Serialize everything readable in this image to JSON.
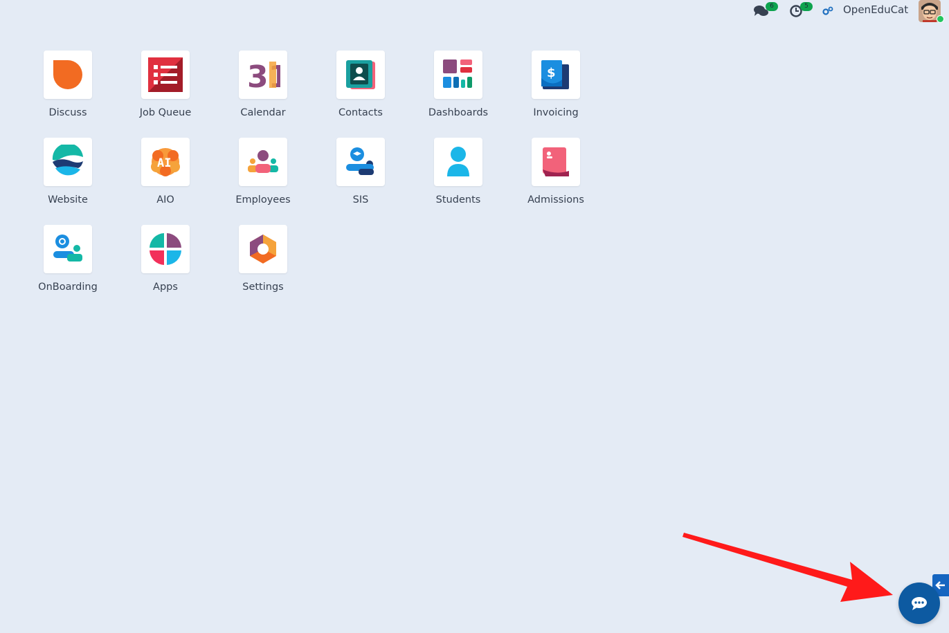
{
  "topbar": {
    "messages_count": "6",
    "activities_count": "5",
    "company_name": "OpenEduCat"
  },
  "apps": [
    {
      "label": "Discuss",
      "icon": "discuss-icon"
    },
    {
      "label": "Job Queue",
      "icon": "job-queue-icon"
    },
    {
      "label": "Calendar",
      "icon": "calendar-icon",
      "icon_text": "31"
    },
    {
      "label": "Contacts",
      "icon": "contacts-icon"
    },
    {
      "label": "Dashboards",
      "icon": "dashboards-icon"
    },
    {
      "label": "Invoicing",
      "icon": "invoicing-icon",
      "icon_text": "$"
    },
    {
      "label": "Website",
      "icon": "website-icon"
    },
    {
      "label": "AIO",
      "icon": "aio-icon",
      "icon_text": "AI"
    },
    {
      "label": "Employees",
      "icon": "employees-icon"
    },
    {
      "label": "SIS",
      "icon": "sis-icon"
    },
    {
      "label": "Students",
      "icon": "students-icon"
    },
    {
      "label": "Admissions",
      "icon": "admissions-icon"
    },
    {
      "label": "OnBoarding",
      "icon": "onboarding-icon"
    },
    {
      "label": "Apps",
      "icon": "apps-icon"
    },
    {
      "label": "Settings",
      "icon": "settings-icon"
    }
  ],
  "colors": {
    "background": "#e4ebf5",
    "badge": "#0da34e",
    "chat_button": "#0d5aa1",
    "arrow": "#ff1a1a"
  }
}
